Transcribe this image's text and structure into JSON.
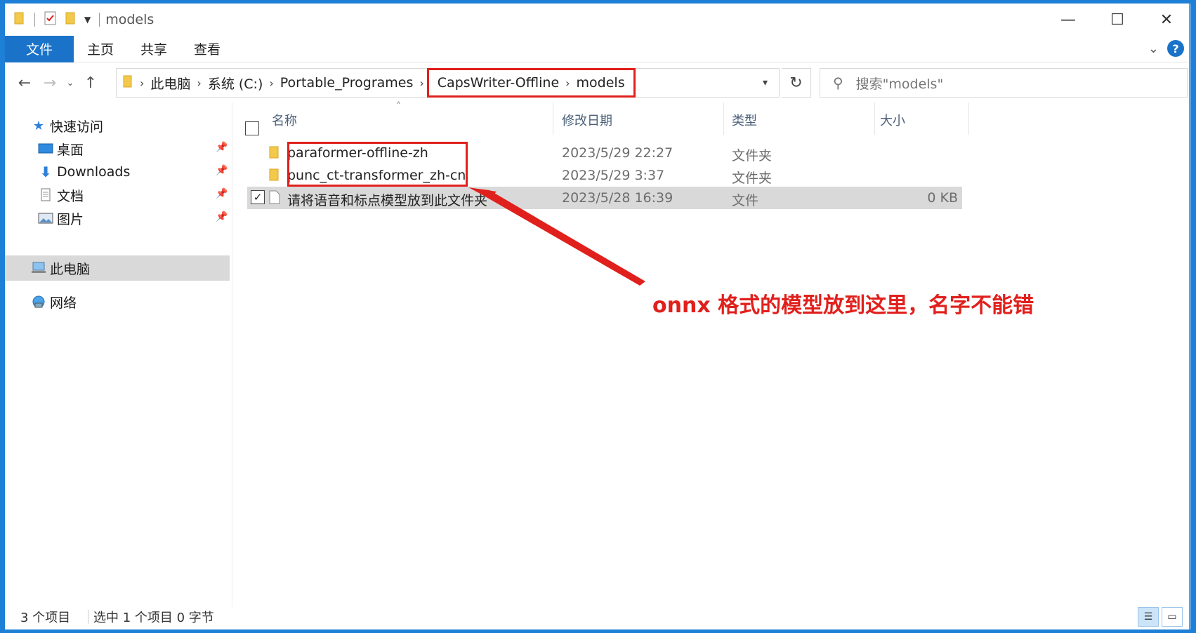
{
  "window": {
    "title": "models",
    "controls": {
      "minimize": "—",
      "maximize": "☐",
      "close": "✕"
    }
  },
  "ribbon": {
    "tabs": [
      "文件",
      "主页",
      "共享",
      "查看"
    ]
  },
  "address": {
    "crumbs": [
      "此电脑",
      "系统 (C:)",
      "Portable_Programes"
    ],
    "highlighted_crumbs": [
      "CapsWriter-Offline",
      "models"
    ]
  },
  "search": {
    "placeholder": "搜索\"models\""
  },
  "sidebar": {
    "quick_access": "快速访问",
    "items": [
      {
        "label": "桌面",
        "icon": "desktop-icon"
      },
      {
        "label": "Downloads",
        "icon": "download-icon"
      },
      {
        "label": "文档",
        "icon": "document-icon"
      },
      {
        "label": "图片",
        "icon": "pictures-icon"
      }
    ],
    "this_pc": "此电脑",
    "network": "网络"
  },
  "columns": {
    "name": "名称",
    "modified": "修改日期",
    "type": "类型",
    "size": "大小"
  },
  "files": [
    {
      "name": "paraformer-offline-zh",
      "modified": "2023/5/29 22:27",
      "type": "文件夹",
      "size": "",
      "kind": "folder",
      "selected": false
    },
    {
      "name": "punc_ct-transformer_zh-cn",
      "modified": "2023/5/29 3:37",
      "type": "文件夹",
      "size": "",
      "kind": "folder",
      "selected": false
    },
    {
      "name": "请将语音和标点模型放到此文件夹",
      "modified": "2023/5/28 16:39",
      "type": "文件",
      "size": "0 KB",
      "kind": "file",
      "selected": true
    }
  ],
  "annotation": {
    "text": "onnx 格式的模型放到这里，名字不能错",
    "color": "#e0201c"
  },
  "status": {
    "count": "3 个项目",
    "selection": "选中 1 个项目  0 字节"
  },
  "colors": {
    "accent": "#1a73c8",
    "highlight": "#e0201c",
    "selected_row": "#d9d9d9"
  }
}
